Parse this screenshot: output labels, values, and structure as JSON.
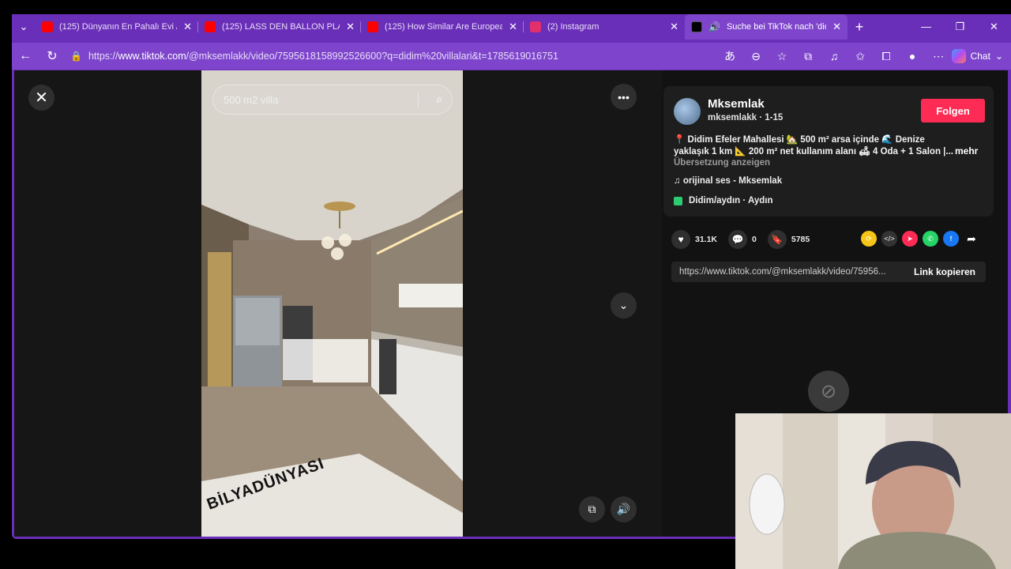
{
  "tabs": [
    {
      "title": "(125) Dünyanın En Pahalı Evi / M",
      "favicon_color": "#ff0000",
      "active": false
    },
    {
      "title": "(125) LASS DEN BALLON PLATZ",
      "favicon_color": "#ff0000",
      "active": false
    },
    {
      "title": "(125) How Similar Are European",
      "favicon_color": "#ff0000",
      "active": false
    },
    {
      "title": "(2) Instagram",
      "favicon_color": "#e1306c",
      "active": false
    },
    {
      "title": "Suche bei TikTok nach 'didi",
      "favicon_color": "#000000",
      "active": true
    }
  ],
  "address_bar": {
    "url_prefix": "https://",
    "url_host": "www.tiktok.com",
    "url_path": "/@mksemlakk/video/7595618158992526600?q=didim%20villalari&t=1785619016751"
  },
  "toolbar": {
    "chat_label": "Chat"
  },
  "video": {
    "search_text": "500 m2 villa",
    "watermark": "BİLYADÜNYASI"
  },
  "author": {
    "display_name": "Mksemlak",
    "handle_line": "mksemlakk · 1-15",
    "follow_label": "Folgen"
  },
  "description": {
    "text": "📍 Didim Efeler Mahallesi 🏡 500 m² arsa içinde 🌊 Denize yaklaşık 1 km 📐 200 m² net kullanım alanı 🛋 4 Oda + 1 Salon |...",
    "more_label": "mehr",
    "translate_label": "Übersetzung anzeigen"
  },
  "music": "♫  orijinal ses - Mksemlak",
  "location": "Didim/aydın · Aydın",
  "stats": {
    "likes": "31.1K",
    "comments": "0",
    "saves": "5785"
  },
  "share": {
    "link": "https://www.tiktok.com/@mksemlakk/video/75956...",
    "copy_label": "Link kopieren"
  }
}
